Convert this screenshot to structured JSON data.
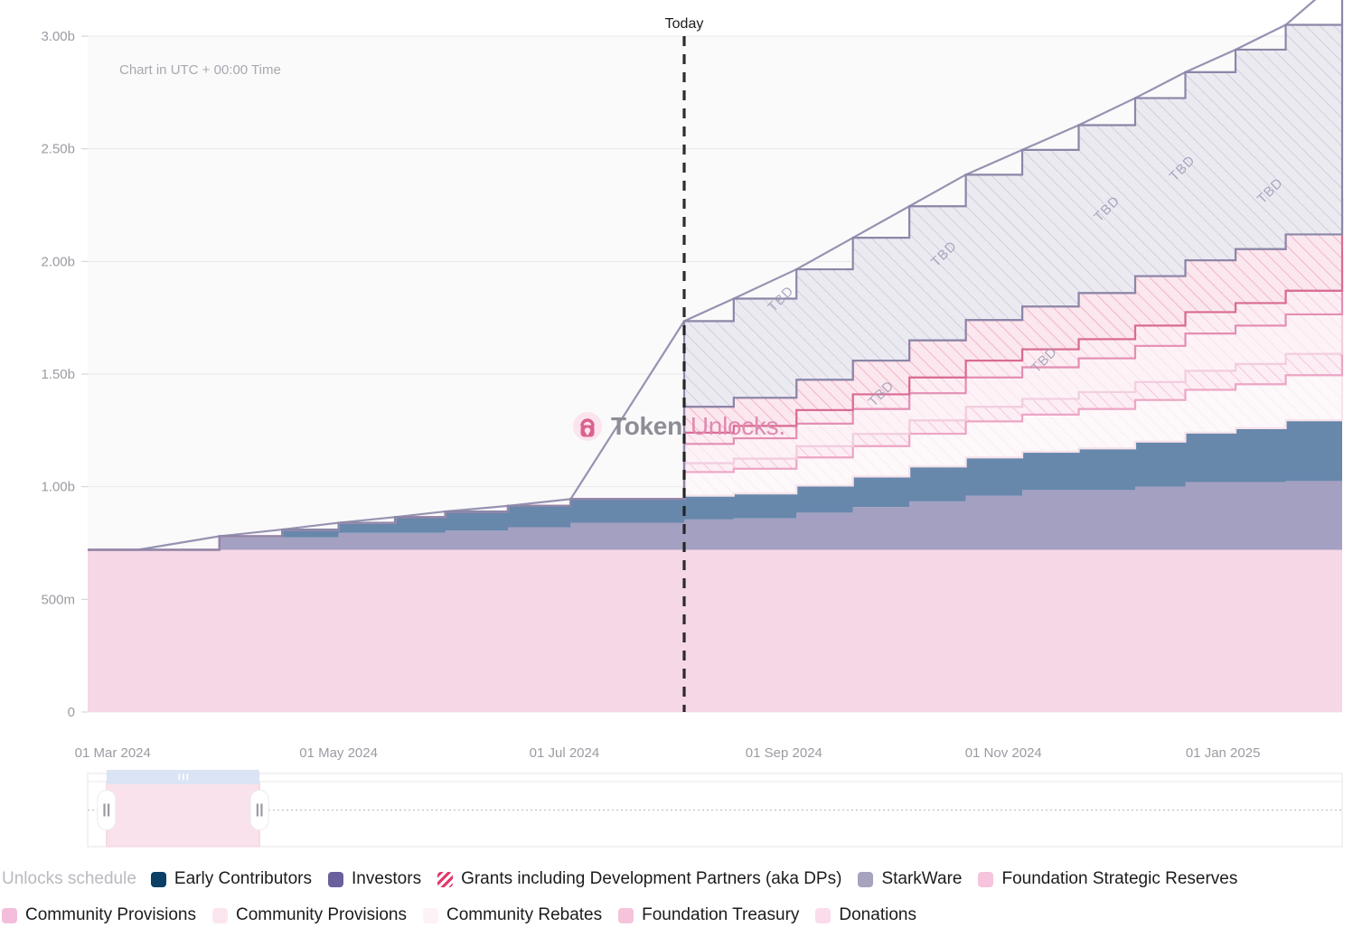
{
  "chart_data": {
    "type": "area",
    "title": "",
    "subtitle": "Chart in UTC + 00:00 Time",
    "xlabel": "",
    "ylabel": "",
    "ylim": [
      0,
      3000000000
    ],
    "grid": true,
    "stacked": true,
    "step": true,
    "legend_position": "bottom",
    "y_ticks": [
      "0",
      "500m",
      "1.00b",
      "1.50b",
      "2.00b",
      "2.50b",
      "3.00b"
    ],
    "y_tick_values": [
      0,
      500000000,
      1000000000,
      1500000000,
      2000000000,
      2500000000,
      3000000000
    ],
    "x_ticks": [
      "01 Mar 2024",
      "01 May 2024",
      "01 Jul 2024",
      "01 Sep 2024",
      "01 Nov 2024",
      "01 Jan 2025"
    ],
    "x_tick_positions": [
      0.02,
      0.2,
      0.38,
      0.555,
      0.73,
      0.905
    ],
    "today_marker": {
      "label": "Today",
      "x_fraction": 0.4755
    },
    "annotation_tbd": "TBD",
    "tbd_positions": [
      {
        "x": 0.555,
        "y": 1.82
      },
      {
        "x": 0.685,
        "y": 2.02
      },
      {
        "x": 0.815,
        "y": 2.22
      },
      {
        "x": 0.875,
        "y": 2.4
      },
      {
        "x": 0.945,
        "y": 2.3
      },
      {
        "x": 0.635,
        "y": 1.4
      },
      {
        "x": 0.765,
        "y": 1.55
      }
    ],
    "x_points": [
      0.0,
      0.04,
      0.105,
      0.155,
      0.2,
      0.245,
      0.285,
      0.335,
      0.385,
      0.4755,
      0.515,
      0.565,
      0.61,
      0.655,
      0.7,
      0.745,
      0.79,
      0.835,
      0.875,
      0.915,
      0.955,
      1.0
    ],
    "series": [
      {
        "name": "Foundation Strategic Reserves",
        "color": "#f5d7e6",
        "hatched": false,
        "values": [
          0.72,
          0.72,
          0.72,
          0.72,
          0.72,
          0.72,
          0.72,
          0.72,
          0.72,
          0.72,
          0.72,
          0.72,
          0.72,
          0.72,
          0.72,
          0.72,
          0.72,
          0.72,
          0.72,
          0.72,
          0.72,
          0.72
        ]
      },
      {
        "name": "Investors",
        "color": "#a4a0c2",
        "hatched": false,
        "values": [
          0.0,
          0.0,
          0.055,
          0.055,
          0.075,
          0.075,
          0.085,
          0.1,
          0.12,
          0.135,
          0.14,
          0.165,
          0.19,
          0.215,
          0.24,
          0.265,
          0.265,
          0.28,
          0.3,
          0.3,
          0.305,
          0.32
        ]
      },
      {
        "name": "Early Contributors",
        "color": "#6787ab",
        "hatched": false,
        "values": [
          0.0,
          0.0,
          0.005,
          0.035,
          0.045,
          0.07,
          0.085,
          0.095,
          0.105,
          0.105,
          0.11,
          0.12,
          0.135,
          0.155,
          0.17,
          0.17,
          0.185,
          0.2,
          0.22,
          0.24,
          0.27,
          0.39
        ]
      },
      {
        "name": "Community Rebates",
        "color": "#fcf2f6",
        "hatched": true,
        "values": [
          0.0,
          0.0,
          0.0,
          0.0,
          0.0,
          0.0,
          0.0,
          0.0,
          0.0,
          0.105,
          0.11,
          0.125,
          0.135,
          0.145,
          0.16,
          0.165,
          0.175,
          0.185,
          0.19,
          0.195,
          0.2,
          0.205
        ]
      },
      {
        "name": "Donations",
        "color": "#f7d6e6",
        "hatched": true,
        "values": [
          0.0,
          0.0,
          0.0,
          0.0,
          0.0,
          0.0,
          0.0,
          0.0,
          0.0,
          0.04,
          0.045,
          0.05,
          0.055,
          0.06,
          0.065,
          0.07,
          0.075,
          0.08,
          0.085,
          0.09,
          0.095,
          0.1
        ]
      },
      {
        "name": "Community Provisions",
        "color": "#fbeef4",
        "hatched": true,
        "values": [
          0.0,
          0.0,
          0.0,
          0.0,
          0.0,
          0.0,
          0.0,
          0.0,
          0.0,
          0.085,
          0.09,
          0.1,
          0.11,
          0.12,
          0.13,
          0.14,
          0.15,
          0.16,
          0.165,
          0.17,
          0.175,
          0.18
        ]
      },
      {
        "name": "Foundation Treasury",
        "color": "#f4c3d9",
        "hatched": true,
        "values": [
          0.0,
          0.0,
          0.0,
          0.0,
          0.0,
          0.0,
          0.0,
          0.0,
          0.0,
          0.05,
          0.055,
          0.06,
          0.065,
          0.07,
          0.075,
          0.08,
          0.085,
          0.09,
          0.095,
          0.1,
          0.105,
          0.11
        ]
      },
      {
        "name": "Grants including Development Partners (aka DPs)",
        "color": "#f6dce6",
        "hatched": true,
        "values": [
          0.0,
          0.0,
          0.0,
          0.0,
          0.0,
          0.0,
          0.0,
          0.0,
          0.0,
          0.115,
          0.125,
          0.135,
          0.15,
          0.165,
          0.18,
          0.19,
          0.205,
          0.22,
          0.23,
          0.24,
          0.25,
          0.26
        ]
      },
      {
        "name": "StarkWare",
        "color": "#e9e8ef",
        "hatched": true,
        "values": [
          0.0,
          0.0,
          0.0,
          0.0,
          0.0,
          0.0,
          0.0,
          0.0,
          0.0,
          0.38,
          0.44,
          0.49,
          0.545,
          0.595,
          0.645,
          0.695,
          0.745,
          0.79,
          0.835,
          0.885,
          0.93,
          0.98
        ]
      }
    ]
  },
  "header": {
    "utc_note": "Chart in UTC + 00:00 Time",
    "today_label": "Today"
  },
  "watermark": {
    "icon": "unlock-icon",
    "text_primary": "Token",
    "text_secondary": "Unlocks."
  },
  "range_slider": {
    "selection_start_fraction": 0.015,
    "selection_end_fraction": 0.137,
    "left_handle_icon": "drag-handle-icon",
    "right_handle_icon": "drag-handle-icon",
    "top_bar_icon": "grip-icon"
  },
  "legend": {
    "title": "Unlocks schedule",
    "row1": [
      {
        "label": "Early Contributors",
        "color": "#0c3f66",
        "hatched": false
      },
      {
        "label": "Investors",
        "color": "#6b5f9e",
        "hatched": false
      },
      {
        "label": "Grants including Development Partners (aka DPs)",
        "color": "#e03a6d",
        "hatched": true
      },
      {
        "label": "StarkWare",
        "color": "#a5a3bd",
        "hatched": false
      },
      {
        "label": "Foundation Strategic Reserves",
        "color": "#f6c4dc",
        "hatched": false
      }
    ],
    "row2": [
      {
        "label": "Community Provisions",
        "color": "#f2bedb",
        "hatched": false
      },
      {
        "label": "Community Provisions",
        "color": "#fbe6f0",
        "hatched": false
      },
      {
        "label": "Community Rebates",
        "color": "#fdf2f7",
        "hatched": false
      },
      {
        "label": "Foundation Treasury",
        "color": "#f5c3da",
        "hatched": false
      },
      {
        "label": "Donations",
        "color": "#fadcea",
        "hatched": false
      }
    ]
  },
  "colors": {
    "background": "#ffffff",
    "plot_background": "#fafafa",
    "grid": "#e8e8ec",
    "today_line": "#1c1c1e",
    "axis_text": "#9b9ba3",
    "brand_pink": "#e08ab0"
  }
}
